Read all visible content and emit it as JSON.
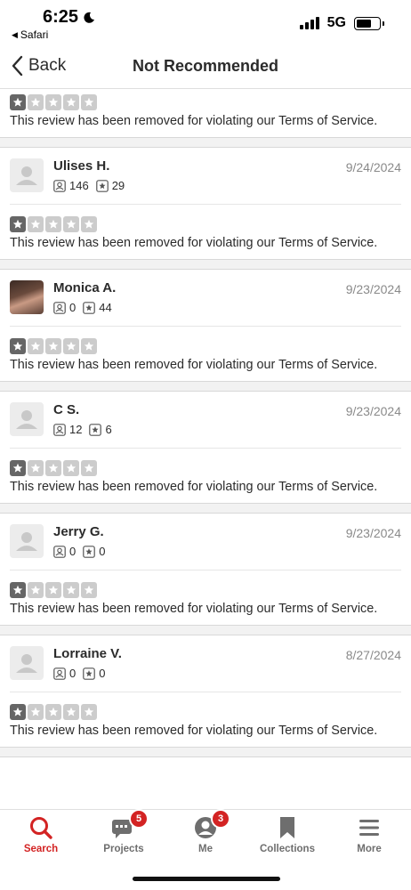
{
  "status": {
    "time": "6:25",
    "back_app": "Safari",
    "network": "5G"
  },
  "nav": {
    "back_label": "Back",
    "title": "Not Recommended"
  },
  "removed_text": "This review has been removed for violating our Terms of Service.",
  "first_rating": 1,
  "reviews": [
    {
      "name": "Ulises H.",
      "friends": "146",
      "reviews": "29",
      "date": "9/24/2024",
      "rating": 1,
      "photo": false
    },
    {
      "name": "Monica A.",
      "friends": "0",
      "reviews": "44",
      "date": "9/23/2024",
      "rating": 1,
      "photo": true
    },
    {
      "name": "C S.",
      "friends": "12",
      "reviews": "6",
      "date": "9/23/2024",
      "rating": 1,
      "photo": false
    },
    {
      "name": "Jerry G.",
      "friends": "0",
      "reviews": "0",
      "date": "9/23/2024",
      "rating": 1,
      "photo": false
    },
    {
      "name": "Lorraine V.",
      "friends": "0",
      "reviews": "0",
      "date": "8/27/2024",
      "rating": 1,
      "photo": false
    }
  ],
  "tabs": [
    {
      "label": "Search",
      "icon": "search-icon",
      "active": true,
      "badge": ""
    },
    {
      "label": "Projects",
      "icon": "projects-icon",
      "active": false,
      "badge": "5"
    },
    {
      "label": "Me",
      "icon": "me-icon",
      "active": false,
      "badge": "3"
    },
    {
      "label": "Collections",
      "icon": "bookmark-icon",
      "active": false,
      "badge": ""
    },
    {
      "label": "More",
      "icon": "menu-icon",
      "active": false,
      "badge": ""
    }
  ],
  "colors": {
    "accent": "#d32323",
    "star_on": "#666666",
    "star_off": "#cccccc"
  }
}
